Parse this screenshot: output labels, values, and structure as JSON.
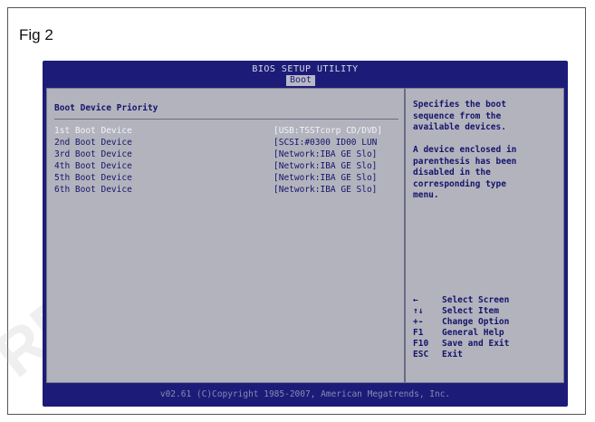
{
  "figure_label": "Fig 2",
  "watermark": "REPUBLISH",
  "bios": {
    "title": "BIOS SETUP UTILITY",
    "active_tab": "Boot",
    "section_title": "Boot Device Priority",
    "boot_devices": [
      {
        "label": "1st Boot Device",
        "value": "[USB:TSSTcorp CD/DVD]",
        "selected": true
      },
      {
        "label": "2nd Boot Device",
        "value": "[SCSI:#0300 ID00 LUN",
        "selected": false
      },
      {
        "label": "3rd Boot Device",
        "value": "[Network:IBA GE Slo]",
        "selected": false
      },
      {
        "label": "4th Boot Device",
        "value": "[Network:IBA GE Slo]",
        "selected": false
      },
      {
        "label": "5th Boot Device",
        "value": "[Network:IBA GE Slo]",
        "selected": false
      },
      {
        "label": "6th Boot Device",
        "value": "[Network:IBA GE Slo]",
        "selected": false
      }
    ],
    "help_text_1": "Specifies the boot\nsequence from the\navailable devices.",
    "help_text_2": "A device enclosed in\nparenthesis has been\ndisabled in the\ncorresponding type\nmenu.",
    "keys": [
      {
        "key": "←",
        "desc": "Select Screen"
      },
      {
        "key": "↑↓",
        "desc": "Select Item"
      },
      {
        "key": "+-",
        "desc": "Change Option"
      },
      {
        "key": "F1",
        "desc": "General Help"
      },
      {
        "key": "F10",
        "desc": "Save and Exit"
      },
      {
        "key": "ESC",
        "desc": "Exit"
      }
    ],
    "footer": "v02.61 (C)Copyright 1985-2007, American Megatrends, Inc."
  },
  "colors": {
    "bios_blue": "#1c1c78",
    "bios_panel_gray": "#b3b3be",
    "bios_text": "#14146a"
  }
}
